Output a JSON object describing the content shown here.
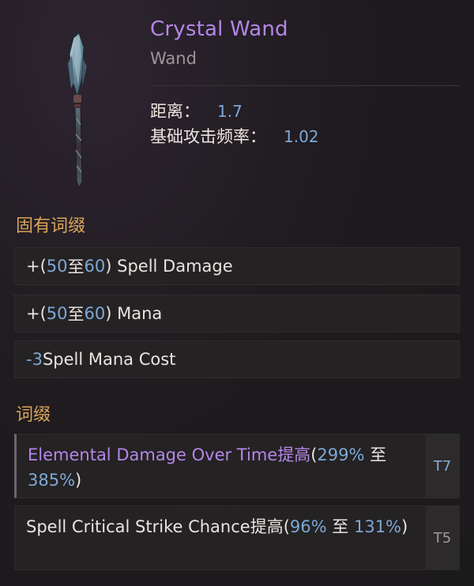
{
  "item": {
    "name": "Crystal Wand",
    "type": "Wand",
    "stats": [
      {
        "label": "距离：",
        "value": "1.7"
      },
      {
        "label": "基础攻击频率：",
        "value": "1.02"
      }
    ]
  },
  "implicit": {
    "title": "固有词缀",
    "mods": [
      {
        "prefix": "+(",
        "min": "50",
        "sep": " 至 ",
        "max": "60",
        "suffix": ") Spell Damage"
      },
      {
        "prefix": "+(",
        "min": "50",
        "sep": " 至 ",
        "max": "60",
        "suffix": ") Mana"
      },
      {
        "prefix": "",
        "min": "-3",
        "sep": "",
        "max": "",
        "suffix": " Spell Mana Cost"
      }
    ]
  },
  "affixes": {
    "title": "词缀",
    "items": [
      {
        "name": "Elemental Damage Over Time提高",
        "open": "(",
        "min": "299%",
        "sep": " 至 ",
        "max": "385%",
        "close": ")",
        "tier": "T7"
      },
      {
        "name": "Spell Critical Strike Chance提高",
        "open": "(",
        "min": "96%",
        "sep": " 至 ",
        "max": "131%",
        "close": ")",
        "tier": "T5"
      }
    ]
  },
  "colors": {
    "item_name": "#b486e8",
    "section_title": "#d8a45b",
    "number": "#7ea8d6"
  },
  "icons": {
    "item_art": "crystal-wand-icon"
  }
}
